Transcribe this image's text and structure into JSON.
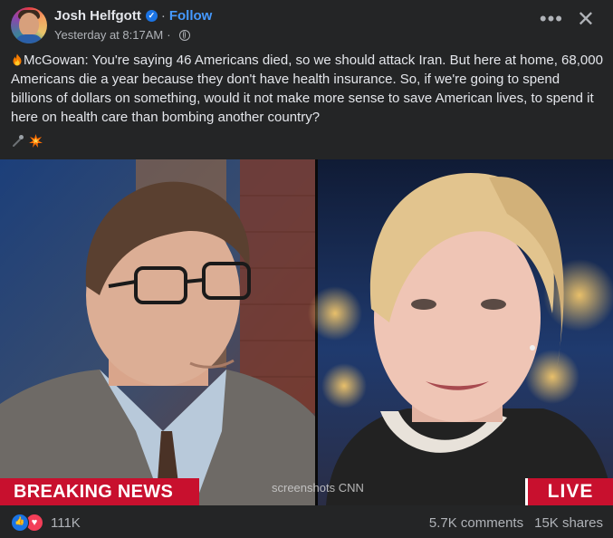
{
  "header": {
    "author": "Josh Helfgott",
    "follow_label": "Follow",
    "timestamp": "Yesterday at 8:17AM",
    "separator": "·"
  },
  "post": {
    "text": "McGowan: You're saying 46 Americans died, so we should attack Iran. But here at home, 68,000 Americans die a year because they don't have health insurance. So, if we're going to spend billions of dollars on something, would it not make more sense to save American lives, to spend it here on health care than bombing another country?",
    "leading_emoji": "fire-emoji",
    "trailing_emojis": [
      "microphone-emoji",
      "collision-emoji"
    ]
  },
  "media": {
    "banner_left": "BREAKING NEWS",
    "banner_right": "LIVE",
    "watermark": "screenshots CNN"
  },
  "footer": {
    "reaction_count": "111K",
    "comments": "5.7K comments",
    "shares": "15K shares",
    "reaction_icons": [
      "like-icon",
      "love-icon"
    ]
  },
  "colors": {
    "background": "#242526",
    "text": "#e4e6eb",
    "secondary_text": "#b0b3b8",
    "link_blue": "#4599ff",
    "banner_red": "#c8102e"
  }
}
